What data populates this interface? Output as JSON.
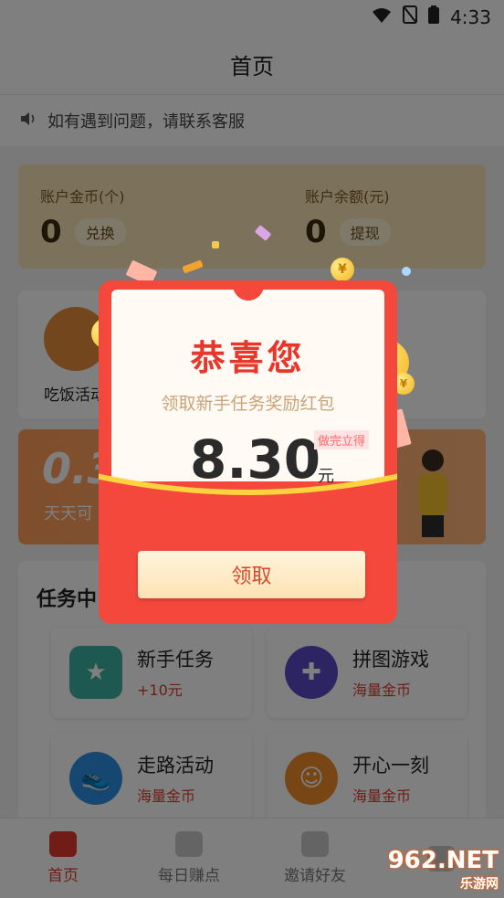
{
  "status": {
    "time": "4:33"
  },
  "header": {
    "title": "首页"
  },
  "notice": {
    "text": "如有遇到问题，请联系客服"
  },
  "account": {
    "coins_label": "账户金币(个)",
    "coins_value": "0",
    "coins_button": "兑换",
    "balance_label": "账户余额(元)",
    "balance_value": "0",
    "balance_button": "提现"
  },
  "features": {
    "first_label": "吃饭活动"
  },
  "banner": {
    "big_text": "0.3",
    "small_text": "天天可"
  },
  "tasks": {
    "title": "任务中",
    "items": [
      {
        "title": "新手任务",
        "sub": "+10元",
        "color": "#3bb3a3"
      },
      {
        "title": "拼图游戏",
        "sub": "海量金币",
        "color": "#5a49c9"
      },
      {
        "title": "走路活动",
        "sub": "海量金币",
        "color": "#2a8fe0"
      },
      {
        "title": "开心一刻",
        "sub": "海量金币",
        "color": "#f08a2a"
      }
    ]
  },
  "nav": [
    {
      "label": "首页",
      "active": true
    },
    {
      "label": "每日赚点",
      "active": false
    },
    {
      "label": "邀请好友",
      "active": false
    }
  ],
  "popup": {
    "title": "恭喜您",
    "subtitle": "领取新手任务奖励红包",
    "amount": "8.30",
    "unit": "元",
    "tag": "做完立得",
    "button": "领取"
  },
  "watermark": {
    "line1": "962.NET",
    "line2": "乐游网"
  },
  "colors": {
    "accent": "#e23a2e",
    "popup_red": "#f4483c"
  }
}
